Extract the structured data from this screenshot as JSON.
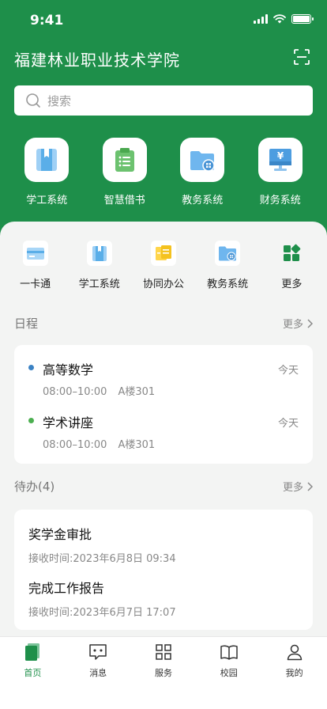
{
  "status": {
    "time": "9:41"
  },
  "header": {
    "title": "福建林业职业技术学院",
    "search_placeholder": "搜索"
  },
  "main_apps": [
    {
      "label": "学工系统",
      "icon": "book-icon"
    },
    {
      "label": "智慧借书",
      "icon": "clipboard-icon"
    },
    {
      "label": "教务系统",
      "icon": "folder-icon"
    },
    {
      "label": "财务系统",
      "icon": "yuan-monitor-icon"
    }
  ],
  "quick_apps": [
    {
      "label": "一卡通",
      "icon": "card-icon"
    },
    {
      "label": "学工系统",
      "icon": "book-icon"
    },
    {
      "label": "协同办公",
      "icon": "office-icon"
    },
    {
      "label": "教务系统",
      "icon": "folder-icon"
    },
    {
      "label": "更多",
      "icon": "grid-more-icon"
    }
  ],
  "schedule": {
    "title": "日程",
    "more": "更多",
    "items": [
      {
        "title": "高等数学",
        "time": "08:00–10:00",
        "place": "A楼301",
        "day": "今天",
        "color": "#3b82c4"
      },
      {
        "title": "学术讲座",
        "time": "08:00–10:00",
        "place": "A楼301",
        "day": "今天",
        "color": "#4caf50"
      }
    ]
  },
  "todo": {
    "title": "待办(4)",
    "more": "更多",
    "items": [
      {
        "title": "奖学金审批",
        "time": "接收时间:2023年6月8日 09:34"
      },
      {
        "title": "完成工作报告",
        "time": "接收时间:2023年6月7日 17:07"
      }
    ]
  },
  "tabbar": [
    {
      "label": "首页",
      "icon": "home-icon",
      "active": true
    },
    {
      "label": "消息",
      "icon": "message-icon",
      "active": false
    },
    {
      "label": "服务",
      "icon": "grid-icon",
      "active": false
    },
    {
      "label": "校园",
      "icon": "open-book-icon",
      "active": false
    },
    {
      "label": "我的",
      "icon": "user-icon",
      "active": false
    }
  ],
  "colors": {
    "brand": "#1e8f4a"
  }
}
